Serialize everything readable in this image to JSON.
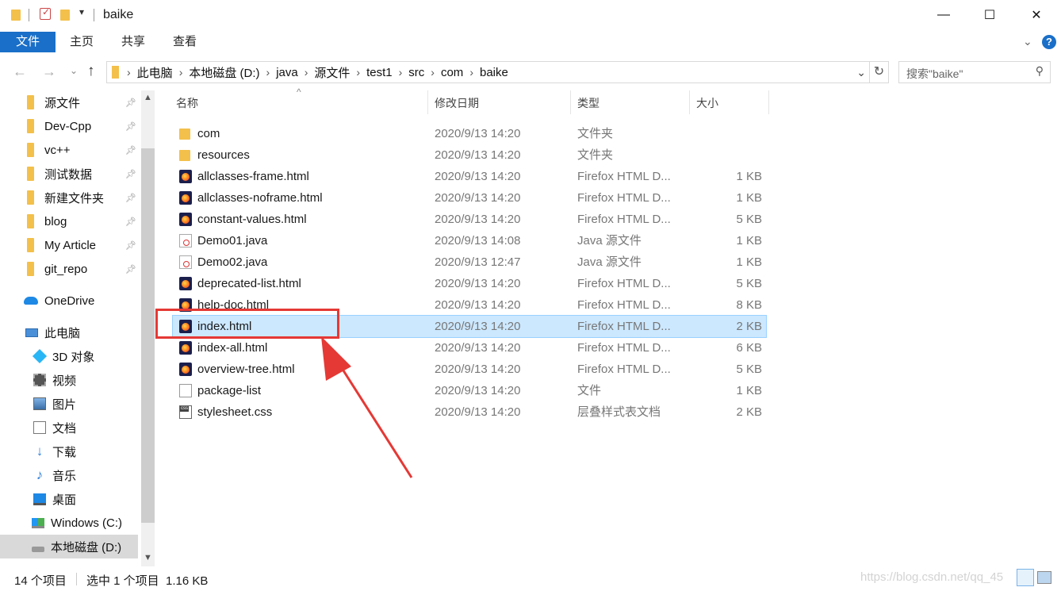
{
  "window": {
    "title": "baike",
    "minimize": "—",
    "maximize": "☐",
    "close": "✕"
  },
  "ribbon": {
    "tabs": [
      {
        "label": "文件",
        "active": true
      },
      {
        "label": "主页"
      },
      {
        "label": "共享"
      },
      {
        "label": "查看"
      }
    ],
    "accent": "#1a6fc8"
  },
  "address": {
    "crumbs": [
      "此电脑",
      "本地磁盘 (D:)",
      "java",
      "源文件",
      "test1",
      "src",
      "com",
      "baike"
    ]
  },
  "search": {
    "placeholder": "搜索\"baike\""
  },
  "sidebar": {
    "quick_access": [
      {
        "label": "源文件",
        "pinned": true
      },
      {
        "label": "Dev-Cpp",
        "pinned": true
      },
      {
        "label": "vc++",
        "pinned": true
      },
      {
        "label": "测试数据",
        "pinned": true
      },
      {
        "label": "新建文件夹",
        "pinned": true
      },
      {
        "label": "blog",
        "pinned": true
      },
      {
        "label": "My Article",
        "pinned": true
      },
      {
        "label": "git_repo",
        "pinned": true
      }
    ],
    "onedrive": "OneDrive",
    "this_pc": "此电脑",
    "pc_items": [
      {
        "label": "3D 对象",
        "icon": "3d-objects-icon"
      },
      {
        "label": "视频",
        "icon": "video-icon"
      },
      {
        "label": "图片",
        "icon": "pictures-icon"
      },
      {
        "label": "文档",
        "icon": "documents-icon"
      },
      {
        "label": "下载",
        "icon": "download-icon"
      },
      {
        "label": "音乐",
        "icon": "music-icon"
      },
      {
        "label": "桌面",
        "icon": "desktop-icon"
      },
      {
        "label": "Windows (C:)",
        "icon": "windows-drive-icon"
      },
      {
        "label": "本地磁盘 (D:)",
        "icon": "drive-icon",
        "selected": true
      }
    ]
  },
  "list": {
    "columns": {
      "name": "名称",
      "date": "修改日期",
      "type": "类型",
      "size": "大小"
    },
    "files": [
      {
        "name": "com",
        "date": "2020/9/13 14:20",
        "type": "文件夹",
        "size": "",
        "icon": "folder"
      },
      {
        "name": "resources",
        "date": "2020/9/13 14:20",
        "type": "文件夹",
        "size": "",
        "icon": "folder"
      },
      {
        "name": "allclasses-frame.html",
        "date": "2020/9/13 14:20",
        "type": "Firefox HTML D...",
        "size": "1 KB",
        "icon": "html"
      },
      {
        "name": "allclasses-noframe.html",
        "date": "2020/9/13 14:20",
        "type": "Firefox HTML D...",
        "size": "1 KB",
        "icon": "html"
      },
      {
        "name": "constant-values.html",
        "date": "2020/9/13 14:20",
        "type": "Firefox HTML D...",
        "size": "5 KB",
        "icon": "html"
      },
      {
        "name": "Demo01.java",
        "date": "2020/9/13 14:08",
        "type": "Java 源文件",
        "size": "1 KB",
        "icon": "java"
      },
      {
        "name": "Demo02.java",
        "date": "2020/9/13 12:47",
        "type": "Java 源文件",
        "size": "1 KB",
        "icon": "java"
      },
      {
        "name": "deprecated-list.html",
        "date": "2020/9/13 14:20",
        "type": "Firefox HTML D...",
        "size": "5 KB",
        "icon": "html"
      },
      {
        "name": "help-doc.html",
        "date": "2020/9/13 14:20",
        "type": "Firefox HTML D...",
        "size": "8 KB",
        "icon": "html"
      },
      {
        "name": "index.html",
        "date": "2020/9/13 14:20",
        "type": "Firefox HTML D...",
        "size": "2 KB",
        "icon": "html",
        "selected": true
      },
      {
        "name": "index-all.html",
        "date": "2020/9/13 14:20",
        "type": "Firefox HTML D...",
        "size": "6 KB",
        "icon": "html"
      },
      {
        "name": "overview-tree.html",
        "date": "2020/9/13 14:20",
        "type": "Firefox HTML D...",
        "size": "5 KB",
        "icon": "html"
      },
      {
        "name": "package-list",
        "date": "2020/9/13 14:20",
        "type": "文件",
        "size": "1 KB",
        "icon": "plain"
      },
      {
        "name": "stylesheet.css",
        "date": "2020/9/13 14:20",
        "type": "层叠样式表文档",
        "size": "2 KB",
        "icon": "css"
      }
    ]
  },
  "status": {
    "count": "14 个项目",
    "selection": "选中 1 个项目  1.16 KB",
    "watermark": "https://blog.csdn.net/qq_45"
  },
  "annotation": {
    "color": "#e53935"
  }
}
